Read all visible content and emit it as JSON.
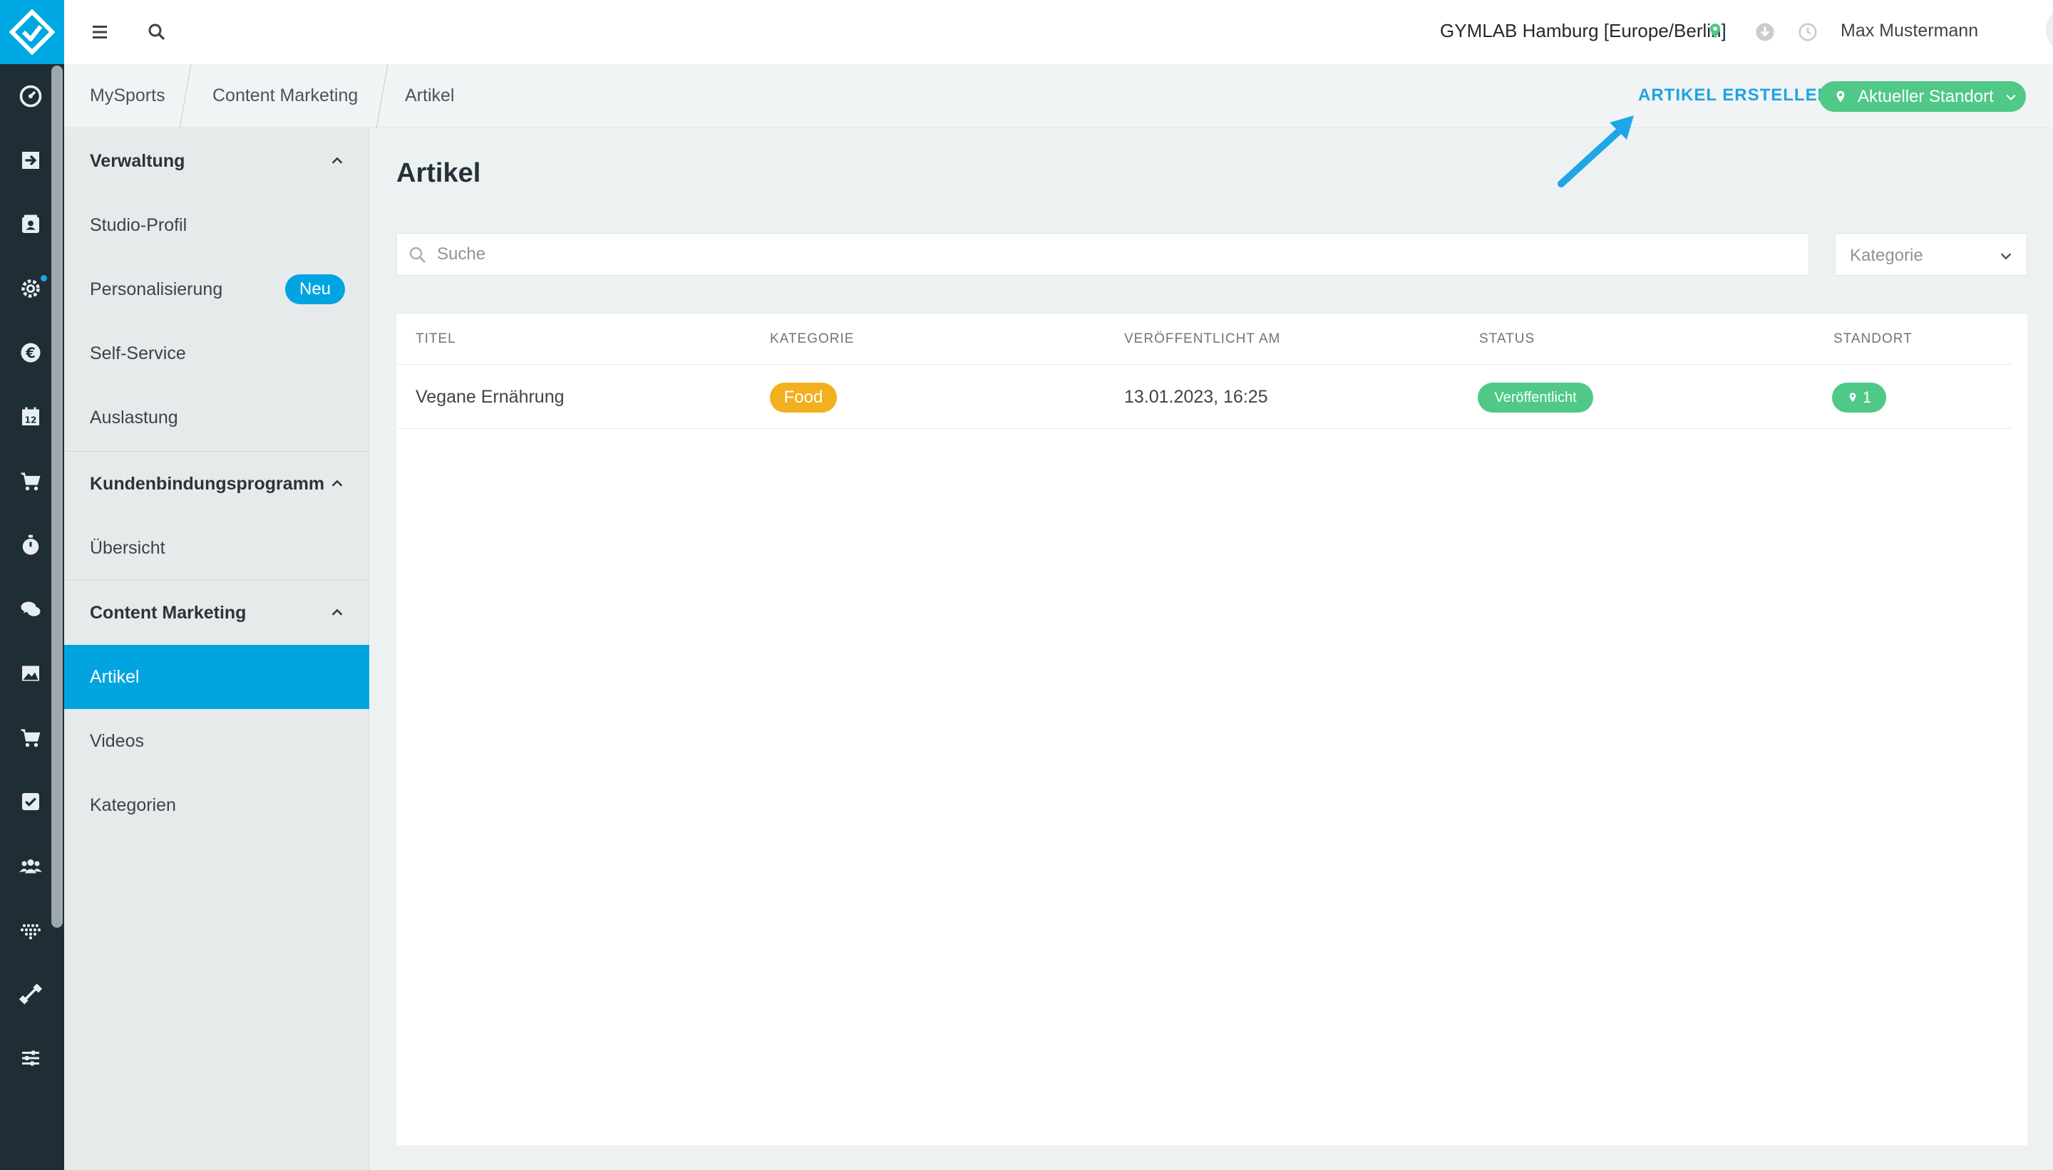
{
  "topbar": {
    "location": "GYMLAB Hamburg [Europe/Berlin]",
    "user_name": "Max Mustermann"
  },
  "breadcrumb": {
    "items": [
      "MySports",
      "Content Marketing",
      "Artikel"
    ]
  },
  "actions": {
    "create_label": "ARTIKEL ERSTELLEN",
    "location_button": "Aktueller Standort"
  },
  "sidebar": {
    "sections": [
      {
        "title": "Verwaltung",
        "items": [
          "Studio-Profil",
          "Personalisierung",
          "Self-Service",
          "Auslastung"
        ]
      },
      {
        "title": "Kundenbindungsprogramm",
        "items": [
          "Übersicht"
        ]
      },
      {
        "title": "Content Marketing",
        "items": [
          "Artikel",
          "Videos",
          "Kategorien"
        ]
      }
    ],
    "badge": "Neu",
    "active_item": "Artikel"
  },
  "main": {
    "title": "Artikel",
    "search_placeholder": "Suche",
    "category_placeholder": "Kategorie"
  },
  "table": {
    "columns": [
      "TITEL",
      "KATEGORIE",
      "VERÖFFENTLICHT AM",
      "STATUS",
      "STANDORT"
    ],
    "rows": [
      {
        "title": "Vegane Ernährung",
        "category": "Food",
        "published": "13.01.2023, 16:25",
        "status": "Veröffentlicht",
        "locations": "1"
      }
    ]
  },
  "colors": {
    "brand": "#00a8e1",
    "rail": "#1f2d34",
    "success": "#4fc888",
    "food": "#f2b01e"
  },
  "icons": {
    "rail": [
      "dashboard-icon",
      "check-in-icon",
      "contacts-icon",
      "settings-icon",
      "euro-icon",
      "calendar-icon",
      "cart-icon",
      "stopwatch-icon",
      "chat-icon",
      "image-icon",
      "shop-icon",
      "checkbox-icon",
      "group-icon",
      "heart-rate-icon",
      "dumbbell-icon",
      "sliders-icon"
    ]
  }
}
